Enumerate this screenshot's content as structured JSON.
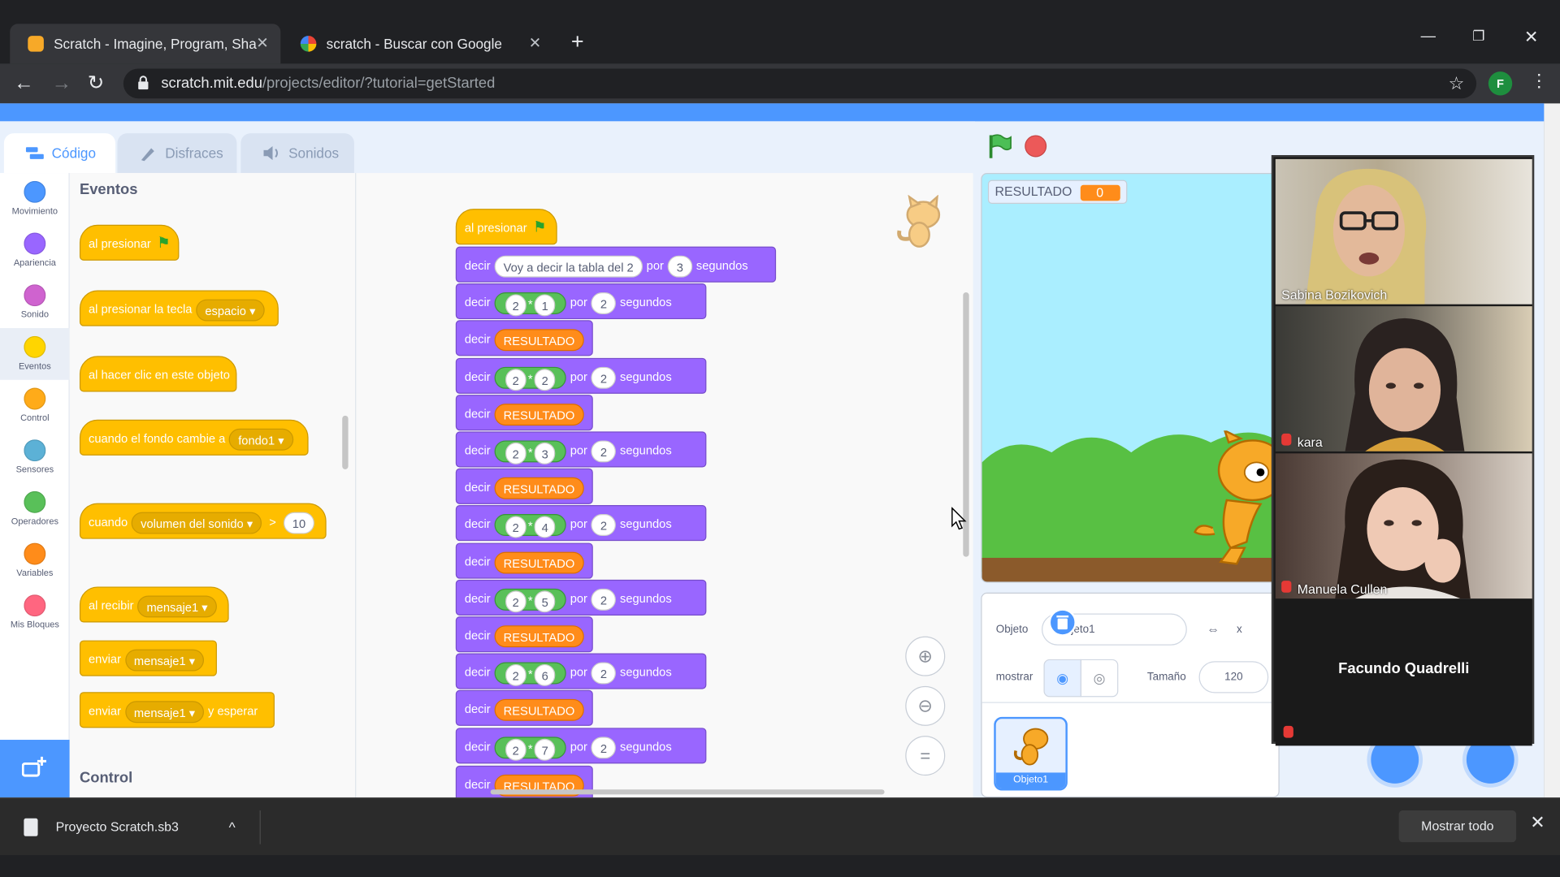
{
  "browser": {
    "tabs": [
      {
        "title": "Scratch - Imagine, Program, Sha",
        "active": true
      },
      {
        "title": "scratch - Buscar con Google",
        "active": false
      }
    ],
    "new_tab_icon": "+",
    "url_host": "scratch.mit.edu",
    "url_path": "/projects/editor/?tutorial=getStarted",
    "profile_initial": "F"
  },
  "scratch": {
    "editor_tabs": [
      {
        "label": "Código"
      },
      {
        "label": "Disfraces"
      },
      {
        "label": "Sonidos"
      }
    ],
    "categories": [
      {
        "label": "Movimiento",
        "color": "#4c97ff"
      },
      {
        "label": "Apariencia",
        "color": "#9966ff"
      },
      {
        "label": "Sonido",
        "color": "#cf63cf"
      },
      {
        "label": "Eventos",
        "color": "#ffd500"
      },
      {
        "label": "Control",
        "color": "#ffab19"
      },
      {
        "label": "Sensores",
        "color": "#5cb1d6"
      },
      {
        "label": "Operadores",
        "color": "#59c059"
      },
      {
        "label": "Variables",
        "color": "#ff8c1a"
      },
      {
        "label": "Mis Bloques",
        "color": "#ff6680"
      }
    ],
    "palette": {
      "section_events": "Eventos",
      "section_control": "Control",
      "blocks": {
        "when_flag": "al presionar",
        "when_key": "al presionar la tecla",
        "key_value": "espacio",
        "when_clicked": "al hacer clic en este objeto",
        "when_backdrop": "cuando el fondo cambie a",
        "backdrop_value": "fondo1",
        "when_sensor": "cuando",
        "sensor_value": "volumen del sonido",
        "sensor_threshold": "10",
        "when_receive": "al recibir",
        "message_value": "mensaje1",
        "broadcast": "enviar",
        "broadcast_wait": "y esperar"
      }
    },
    "script": {
      "hat": "al presionar",
      "first_say": {
        "verb": "decir",
        "text": "Voy a decir la tabla del 2",
        "por": "por",
        "secs": "3",
        "unit": "segundos"
      },
      "say_ops": [
        {
          "a": "2",
          "op": "*",
          "b": "1",
          "secs": "2"
        },
        {
          "a": "2",
          "op": "*",
          "b": "2",
          "secs": "2"
        },
        {
          "a": "2",
          "op": "*",
          "b": "3",
          "secs": "2"
        },
        {
          "a": "2",
          "op": "*",
          "b": "4",
          "secs": "2"
        },
        {
          "a": "2",
          "op": "*",
          "b": "5",
          "secs": "2"
        },
        {
          "a": "2",
          "op": "*",
          "b": "6",
          "secs": "2"
        },
        {
          "a": "2",
          "op": "*",
          "b": "7",
          "secs": "2"
        }
      ],
      "verb": "decir",
      "por": "por",
      "unit": "segundos",
      "variable": "RESULTADO"
    },
    "stage": {
      "monitor_label": "RESULTADO",
      "monitor_value": "0"
    },
    "sprite_info": {
      "sprite_label": "Objeto",
      "sprite_name": "Objeto1",
      "x_label": "x",
      "show_label": "mostrar",
      "size_label": "Tamaño",
      "size_value": "120"
    },
    "sprite_tile_name": "Objeto1"
  },
  "call": {
    "participants": [
      {
        "name": "Sabina Bozikovich"
      },
      {
        "name": "kara"
      },
      {
        "name": "Manuela Cullen"
      },
      {
        "name": "Facundo Quadrelli"
      }
    ]
  },
  "downloads": {
    "file_name": "Proyecto Scratch.sb3",
    "show_all": "Mostrar todo"
  }
}
